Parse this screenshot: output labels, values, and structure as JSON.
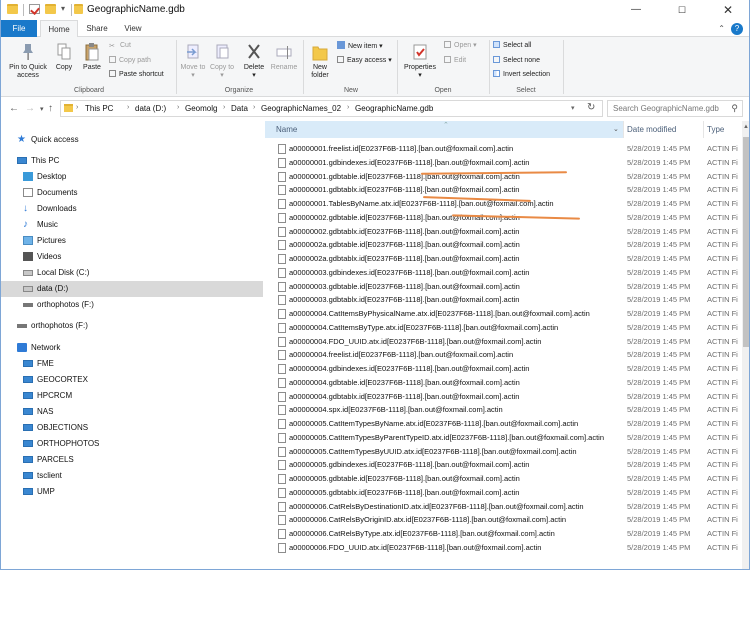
{
  "window": {
    "title": "GeographicName.gdb"
  },
  "ribbon_tabs": [
    "File",
    "Home",
    "Share",
    "View"
  ],
  "ribbon": {
    "clipboard": {
      "label": "Clipboard",
      "pin": "Pin to Quick access",
      "copy": "Copy",
      "paste": "Paste",
      "cut": "Cut",
      "copy_path": "Copy path",
      "paste_shortcut": "Paste shortcut"
    },
    "organize": {
      "label": "Organize",
      "move_to": "Move to",
      "copy_to": "Copy to",
      "delete": "Delete",
      "rename": "Rename"
    },
    "new": {
      "label": "New",
      "new_folder": "New folder",
      "new_item": "New item",
      "easy_access": "Easy access"
    },
    "open": {
      "label": "Open",
      "properties": "Properties",
      "open": "Open",
      "edit": "Edit"
    },
    "select": {
      "label": "Select",
      "select_all": "Select all",
      "select_none": "Select none",
      "invert": "Invert selection"
    }
  },
  "breadcrumb": [
    "This PC",
    "data (D:)",
    "Geomolg",
    "Data",
    "GeographicNames_02",
    "GeographicName.gdb"
  ],
  "search": {
    "placeholder": "Search GeographicName.gdb"
  },
  "nav": [
    {
      "label": "Quick access",
      "icon": "star-icon"
    },
    {
      "label": "This PC",
      "icon": "computer-icon"
    },
    {
      "label": "Desktop",
      "icon": "desktop-icon"
    },
    {
      "label": "Documents",
      "icon": "documents-icon"
    },
    {
      "label": "Downloads",
      "icon": "downloads-icon"
    },
    {
      "label": "Music",
      "icon": "music-icon"
    },
    {
      "label": "Pictures",
      "icon": "pictures-icon"
    },
    {
      "label": "Videos",
      "icon": "videos-icon"
    },
    {
      "label": "Local Disk (C:)",
      "icon": "disk-icon"
    },
    {
      "label": "data (D:)",
      "icon": "disk-icon"
    },
    {
      "label": "orthophotos (F:)",
      "icon": "drive-icon"
    },
    {
      "label": "orthophotos (F:)",
      "icon": "drive-icon"
    },
    {
      "label": "Network",
      "icon": "network-icon"
    },
    {
      "label": "FME",
      "icon": "computer-icon"
    },
    {
      "label": "GEOCORTEX",
      "icon": "computer-icon"
    },
    {
      "label": "HPCRCM",
      "icon": "computer-icon"
    },
    {
      "label": "NAS",
      "icon": "computer-icon"
    },
    {
      "label": "OBJECTIONS",
      "icon": "computer-icon"
    },
    {
      "label": "ORTHOPHOTOS",
      "icon": "computer-icon"
    },
    {
      "label": "PARCELS",
      "icon": "computer-icon"
    },
    {
      "label": "tsclient",
      "icon": "computer-icon"
    },
    {
      "label": "UMP",
      "icon": "computer-icon"
    }
  ],
  "columns": {
    "name": "Name",
    "date": "Date modified",
    "type": "Type"
  },
  "files": [
    {
      "name": "a00000001.freelist.id[E0237F6B-1118].[ban.out@foxmail.com].actin",
      "date": "5/28/2019 1:45 PM",
      "type": "ACTIN Fi"
    },
    {
      "name": "a00000001.gdbindexes.id[E0237F6B-1118].[ban.out@foxmail.com].actin",
      "date": "5/28/2019 1:45 PM",
      "type": "ACTIN Fi"
    },
    {
      "name": "a00000001.gdbtable.id[E0237F6B-1118].[ban.out@foxmail.com].actin",
      "date": "5/28/2019 1:45 PM",
      "type": "ACTIN Fi"
    },
    {
      "name": "a00000001.gdbtablx.id[E0237F6B-1118].[ban.out@foxmail.com].actin",
      "date": "5/28/2019 1:45 PM",
      "type": "ACTIN Fi"
    },
    {
      "name": "a00000001.TablesByName.atx.id[E0237F6B-1118].[ban.out@foxmail.com].actin",
      "date": "5/28/2019 1:45 PM",
      "type": "ACTIN Fi"
    },
    {
      "name": "a00000002.gdbtable.id[E0237F6B-1118].[ban.out@foxmail.com].actin",
      "date": "5/28/2019 1:45 PM",
      "type": "ACTIN Fi"
    },
    {
      "name": "a00000002.gdbtablx.id[E0237F6B-1118].[ban.out@foxmail.com].actin",
      "date": "5/28/2019 1:45 PM",
      "type": "ACTIN Fi"
    },
    {
      "name": "a0000002a.gdbtable.id[E0237F6B-1118].[ban.out@foxmail.com].actin",
      "date": "5/28/2019 1:45 PM",
      "type": "ACTIN Fi"
    },
    {
      "name": "a0000002a.gdbtablx.id[E0237F6B-1118].[ban.out@foxmail.com].actin",
      "date": "5/28/2019 1:45 PM",
      "type": "ACTIN Fi"
    },
    {
      "name": "a00000003.gdbindexes.id[E0237F6B-1118].[ban.out@foxmail.com].actin",
      "date": "5/28/2019 1:45 PM",
      "type": "ACTIN Fi"
    },
    {
      "name": "a00000003.gdbtable.id[E0237F6B-1118].[ban.out@foxmail.com].actin",
      "date": "5/28/2019 1:45 PM",
      "type": "ACTIN Fi"
    },
    {
      "name": "a00000003.gdbtablx.id[E0237F6B-1118].[ban.out@foxmail.com].actin",
      "date": "5/28/2019 1:45 PM",
      "type": "ACTIN Fi"
    },
    {
      "name": "a00000004.CatItemsByPhysicalName.atx.id[E0237F6B-1118].[ban.out@foxmail.com].actin",
      "date": "5/28/2019 1:45 PM",
      "type": "ACTIN Fi"
    },
    {
      "name": "a00000004.CatItemsByType.atx.id[E0237F6B-1118].[ban.out@foxmail.com].actin",
      "date": "5/28/2019 1:45 PM",
      "type": "ACTIN Fi"
    },
    {
      "name": "a00000004.FDO_UUID.atx.id[E0237F6B-1118].[ban.out@foxmail.com].actin",
      "date": "5/28/2019 1:45 PM",
      "type": "ACTIN Fi"
    },
    {
      "name": "a00000004.freelist.id[E0237F6B-1118].[ban.out@foxmail.com].actin",
      "date": "5/28/2019 1:45 PM",
      "type": "ACTIN Fi"
    },
    {
      "name": "a00000004.gdbindexes.id[E0237F6B-1118].[ban.out@foxmail.com].actin",
      "date": "5/28/2019 1:45 PM",
      "type": "ACTIN Fi"
    },
    {
      "name": "a00000004.gdbtable.id[E0237F6B-1118].[ban.out@foxmail.com].actin",
      "date": "5/28/2019 1:45 PM",
      "type": "ACTIN Fi"
    },
    {
      "name": "a00000004.gdbtablx.id[E0237F6B-1118].[ban.out@foxmail.com].actin",
      "date": "5/28/2019 1:45 PM",
      "type": "ACTIN Fi"
    },
    {
      "name": "a00000004.spx.id[E0237F6B-1118].[ban.out@foxmail.com].actin",
      "date": "5/28/2019 1:45 PM",
      "type": "ACTIN Fi"
    },
    {
      "name": "a00000005.CatItemTypesByName.atx.id[E0237F6B-1118].[ban.out@foxmail.com].actin",
      "date": "5/28/2019 1:45 PM",
      "type": "ACTIN Fi"
    },
    {
      "name": "a00000005.CatItemTypesByParentTypeID.atx.id[E0237F6B-1118].[ban.out@foxmail.com].actin",
      "date": "5/28/2019 1:45 PM",
      "type": "ACTIN Fi"
    },
    {
      "name": "a00000005.CatItemTypesByUUID.atx.id[E0237F6B-1118].[ban.out@foxmail.com].actin",
      "date": "5/28/2019 1:45 PM",
      "type": "ACTIN Fi"
    },
    {
      "name": "a00000005.gdbindexes.id[E0237F6B-1118].[ban.out@foxmail.com].actin",
      "date": "5/28/2019 1:45 PM",
      "type": "ACTIN Fi"
    },
    {
      "name": "a00000005.gdbtable.id[E0237F6B-1118].[ban.out@foxmail.com].actin",
      "date": "5/28/2019 1:45 PM",
      "type": "ACTIN Fi"
    },
    {
      "name": "a00000005.gdbtablx.id[E0237F6B-1118].[ban.out@foxmail.com].actin",
      "date": "5/28/2019 1:45 PM",
      "type": "ACTIN Fi"
    },
    {
      "name": "a00000006.CatRelsByDestinationID.atx.id[E0237F6B-1118].[ban.out@foxmail.com].actin",
      "date": "5/28/2019 1:45 PM",
      "type": "ACTIN Fi"
    },
    {
      "name": "a00000006.CatRelsByOriginID.atx.id[E0237F6B-1118].[ban.out@foxmail.com].actin",
      "date": "5/28/2019 1:45 PM",
      "type": "ACTIN Fi"
    },
    {
      "name": "a00000006.CatRelsByType.atx.id[E0237F6B-1118].[ban.out@foxmail.com].actin",
      "date": "5/28/2019 1:45 PM",
      "type": "ACTIN Fi"
    },
    {
      "name": "a00000006.FDO_UUID.atx.id[E0237F6B-1118].[ban.out@foxmail.com].actin",
      "date": "5/28/2019 1:45 PM",
      "type": "ACTIN Fi"
    }
  ],
  "colors": {
    "accent": "#1979ca",
    "selection": "#cce8ff",
    "annotation": "#e98a45"
  }
}
